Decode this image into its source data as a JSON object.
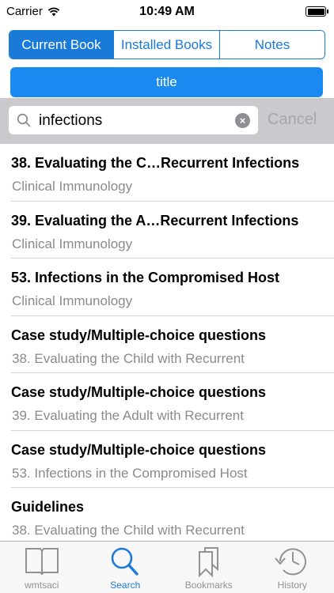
{
  "status_bar": {
    "carrier": "Carrier",
    "time": "10:49 AM"
  },
  "segments": [
    {
      "label": "Current Book",
      "active": true
    },
    {
      "label": "Installed Books",
      "active": false
    },
    {
      "label": "Notes",
      "active": false
    }
  ],
  "title_button": "title",
  "search": {
    "value": "infections",
    "cancel_label": "Cancel"
  },
  "results": [
    {
      "title": "38. Evaluating the C…Recurrent Infections",
      "subtitle": "Clinical Immunology"
    },
    {
      "title": "39. Evaluating the A…Recurrent Infections",
      "subtitle": "Clinical Immunology"
    },
    {
      "title": "53. Infections in the Compromised Host",
      "subtitle": "Clinical Immunology"
    },
    {
      "title": "Case study/Multiple-choice questions",
      "subtitle": "38. Evaluating the Child with Recurrent"
    },
    {
      "title": "Case study/Multiple-choice questions",
      "subtitle": "39. Evaluating the Adult with Recurrent"
    },
    {
      "title": "Case study/Multiple-choice questions",
      "subtitle": "53. Infections in the Compromised Host"
    },
    {
      "title": "Guidelines",
      "subtitle": "38. Evaluating the Child with Recurrent"
    }
  ],
  "tabs": [
    {
      "label": "wmtsaci",
      "icon": "book-icon"
    },
    {
      "label": "Search",
      "icon": "search-icon"
    },
    {
      "label": "Bookmarks",
      "icon": "bookmarks-icon"
    },
    {
      "label": "History",
      "icon": "history-icon"
    }
  ],
  "colors": {
    "accent": "#1a7ad8",
    "title_button": "#1a8af0",
    "search_bar_bg": "#c9c9ce"
  }
}
